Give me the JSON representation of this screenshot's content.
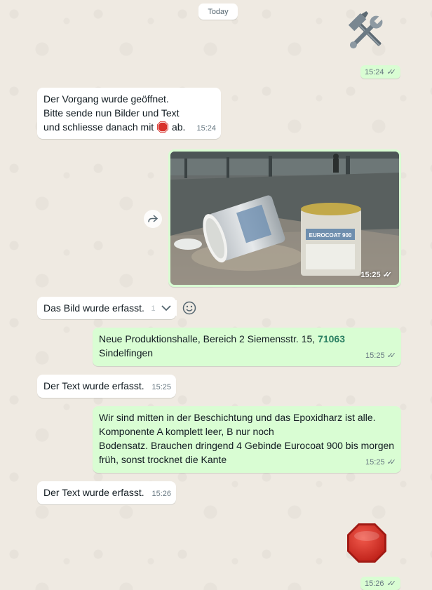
{
  "date_divider": "Today",
  "messages": [
    {
      "emoji": "hammer-and-wrench",
      "time": "15:24"
    },
    {
      "lines": [
        "Der Vorgang wurde geöffnet.",
        "Bitte sende nun Bilder und Text",
        "und schliesse danach mit",
        "ab."
      ],
      "time": "15:24"
    },
    {
      "photo_caption": "EUROCOAT 900",
      "time": "15:25"
    },
    {
      "text": "Das Bild wurde erfasst.",
      "time": "15:25"
    },
    {
      "text_before": "Neue Produktionshalle, Bereich 2 Siemensstr. 15,",
      "link": "71063",
      "text_after": "Sindelfingen",
      "time": "15:25"
    },
    {
      "text": "Der Text wurde erfasst.",
      "time": "15:25"
    },
    {
      "lines": [
        "Wir sind mitten in der Beschichtung und das Epoxidharz ist alle.",
        "Komponente A komplett leer, B nur noch",
        "Bodensatz. Brauchen dringend 4 Gebinde Eurocoat 900 bis morgen",
        "früh, sonst trocknet die Kante"
      ],
      "time": "15:25"
    },
    {
      "text": "Der Text wurde erfasst.",
      "time": "15:26"
    },
    {
      "emoji": "stop-sign",
      "time": "15:26"
    }
  ],
  "colors": {
    "background": "#efeae2",
    "incoming": "#ffffff",
    "outgoing": "#d9fdd3",
    "meta_text": "#667781",
    "link": "#2a7f62"
  }
}
